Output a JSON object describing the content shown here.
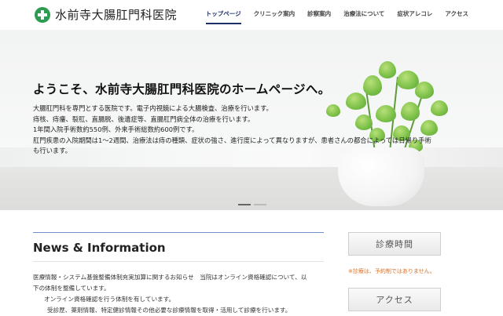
{
  "header": {
    "logo_text": "水前寺大腸肛門科医院",
    "nav": [
      {
        "label": "トップページ",
        "active": true
      },
      {
        "label": "クリニック案内",
        "active": false
      },
      {
        "label": "診察案内",
        "active": false
      },
      {
        "label": "治療法について",
        "active": false
      },
      {
        "label": "症状アレコレ",
        "active": false
      },
      {
        "label": "アクセス",
        "active": false
      }
    ]
  },
  "hero": {
    "title": "ようこそ、水前寺大腸肛門科医院のホームページへ。",
    "lines": [
      "大腸肛門科を専門とする医院です。電子内視鏡による大腸検査、治療を行います。",
      "痔核、痔瘻、裂肛、直腸脱、後遺症等、直腸肛門病全体の治療を行います。",
      "1年間入院手術数約550例、外来手術総数約600例です。",
      "肛門疾患の入院期間は1〜2週間、治療法は痔の種類、症状の強さ、進行度によって異なりますが、患者さんの都合によっては日帰り手術",
      "も行います。"
    ],
    "slides": 2,
    "active_slide": 1
  },
  "news": {
    "heading": "News & Information",
    "lines": [
      "医療情報・システム基盤整備体制充実加算に関するお知らせ　当院はオンライン資格確認について、以",
      "下の体制を整備しています。",
      "オンライン資格確認を行う体制を有しています。",
      "受診歴、薬剤情報、特定健診情報その他必要な診療情報を取得・活用して診療を行います。"
    ]
  },
  "sidebar": {
    "hours_button": "診療時間",
    "note": "※診療は、予約制ではありません。",
    "access_button": "アクセス"
  },
  "colors": {
    "logo_green": "#2e9b52",
    "nav_active": "#1b2e66",
    "news_rule": "#6e8fc8",
    "note_orange": "#e07020"
  }
}
